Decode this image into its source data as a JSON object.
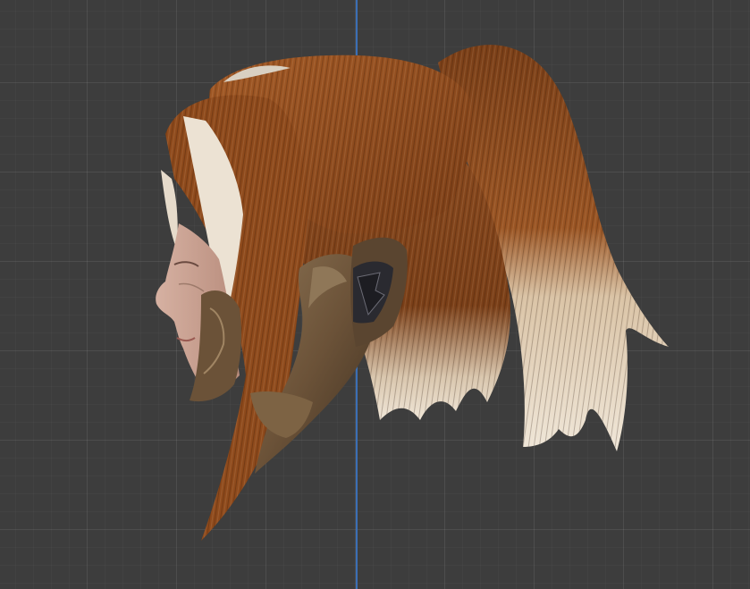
{
  "viewport": {
    "background_color": "#3d3d3d",
    "grid_color": "#4a4a4a",
    "axis_color": "#3b6fb5",
    "axis": "z-axis"
  },
  "model": {
    "icon": "character-head-model",
    "hair_color": "#8a4a1f",
    "hair_tip_color": "#e8ddcc",
    "skin_color": "#c9a394",
    "armor_color": "#6b5238",
    "armor_accent_color": "#2a2a30"
  }
}
